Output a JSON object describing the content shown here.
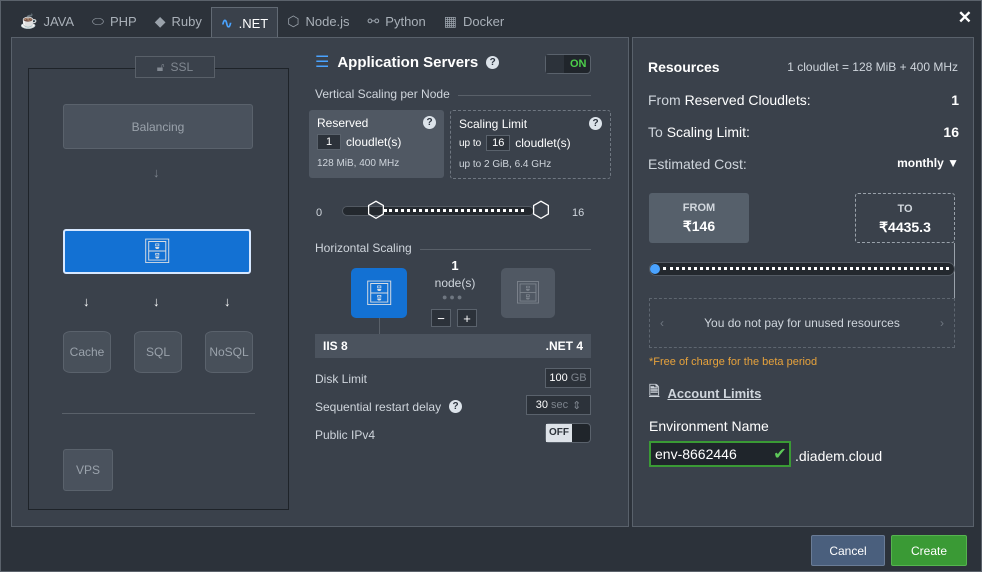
{
  "tabs": [
    {
      "label": "JAVA",
      "icon": "java-icon"
    },
    {
      "label": "PHP",
      "icon": "php-icon"
    },
    {
      "label": "Ruby",
      "icon": "ruby-icon"
    },
    {
      "label": ".NET",
      "icon": "dotnet-icon",
      "active": true
    },
    {
      "label": "Node.js",
      "icon": "nodejs-icon"
    },
    {
      "label": "Python",
      "icon": "python-icon"
    },
    {
      "label": "Docker",
      "icon": "docker-icon"
    }
  ],
  "topology": {
    "ssl": "SSL",
    "balancing": "Balancing",
    "cache": "Cache",
    "sql": "SQL",
    "nosql": "NoSQL",
    "vps": "VPS"
  },
  "app": {
    "title": "Application Servers",
    "toggle": "ON"
  },
  "vertical": {
    "heading": "Vertical Scaling per Node",
    "reserved": {
      "label": "Reserved",
      "value": "1",
      "unit": "cloudlet(s)",
      "spec": "128 MiB, 400 MHz"
    },
    "limit": {
      "label": "Scaling Limit",
      "prefix": "up to",
      "value": "16",
      "unit": "cloudlet(s)",
      "spec": "up to 2 GiB, 6.4 GHz"
    },
    "slider": {
      "min": "0",
      "max": "16",
      "reserved_value": 1,
      "limit_value": 16
    }
  },
  "horizontal": {
    "heading": "Horizontal Scaling",
    "count": "1",
    "unit": "node(s)",
    "minus": "−",
    "plus": "+"
  },
  "stack": {
    "server": "IIS 8",
    "version": ".NET 4"
  },
  "disk": {
    "label": "Disk Limit",
    "value": "100",
    "unit": "GB"
  },
  "restart": {
    "label": "Sequential restart delay",
    "value": "30",
    "unit": "sec"
  },
  "ipv4": {
    "label": "Public IPv4",
    "toggle": "OFF"
  },
  "resources": {
    "title": "Resources",
    "rate": "1 cloudlet = 128 MiB + 400 MHz",
    "from_prefix": "From",
    "from_label": "Reserved Cloudlets:",
    "from_value": "1",
    "to_prefix": "To",
    "to_label": "Scaling Limit:",
    "to_value": "16",
    "cost_label": "Estimated Cost:",
    "period": "monthly",
    "from_head": "FROM",
    "from_price": "₹146",
    "to_head": "TO",
    "to_price": "₹4435.3",
    "notice": "You do not pay for unused resources",
    "free": "*Free of charge for the beta period",
    "account_limits": "Account Limits",
    "env_label": "Environment Name",
    "env_value": "env-8662446",
    "env_suffix": ".diadem.cloud"
  },
  "footer": {
    "cancel": "Cancel",
    "create": "Create"
  },
  "colors": {
    "accent": "#1371d3",
    "create": "#3a9a35",
    "warning": "#e6a23c"
  }
}
